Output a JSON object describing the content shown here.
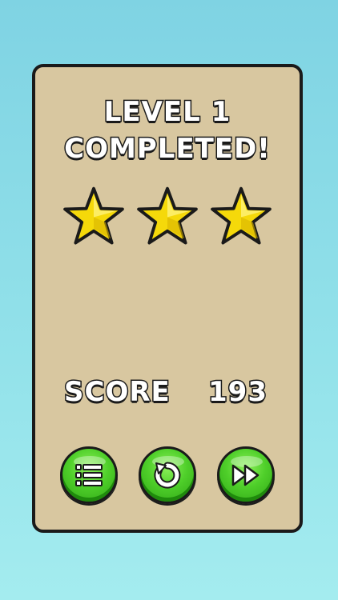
{
  "result": {
    "title_line1": "LEVEL 1",
    "title_line2": "COMPLETED!",
    "stars_earned": 3,
    "stars_total": 3
  },
  "score": {
    "label": "SCORE",
    "value": "193"
  },
  "buttons": [
    {
      "name": "menu",
      "icon": "list-icon"
    },
    {
      "name": "restart",
      "icon": "restart-icon"
    },
    {
      "name": "next",
      "icon": "fast-forward-icon"
    }
  ],
  "colors": {
    "background": "#8fdde8",
    "panel": "#d8c7a0",
    "outline": "#1a1a1a",
    "star": "#f5d90a",
    "button": "#4fcf2a",
    "text": "#ffffff"
  }
}
